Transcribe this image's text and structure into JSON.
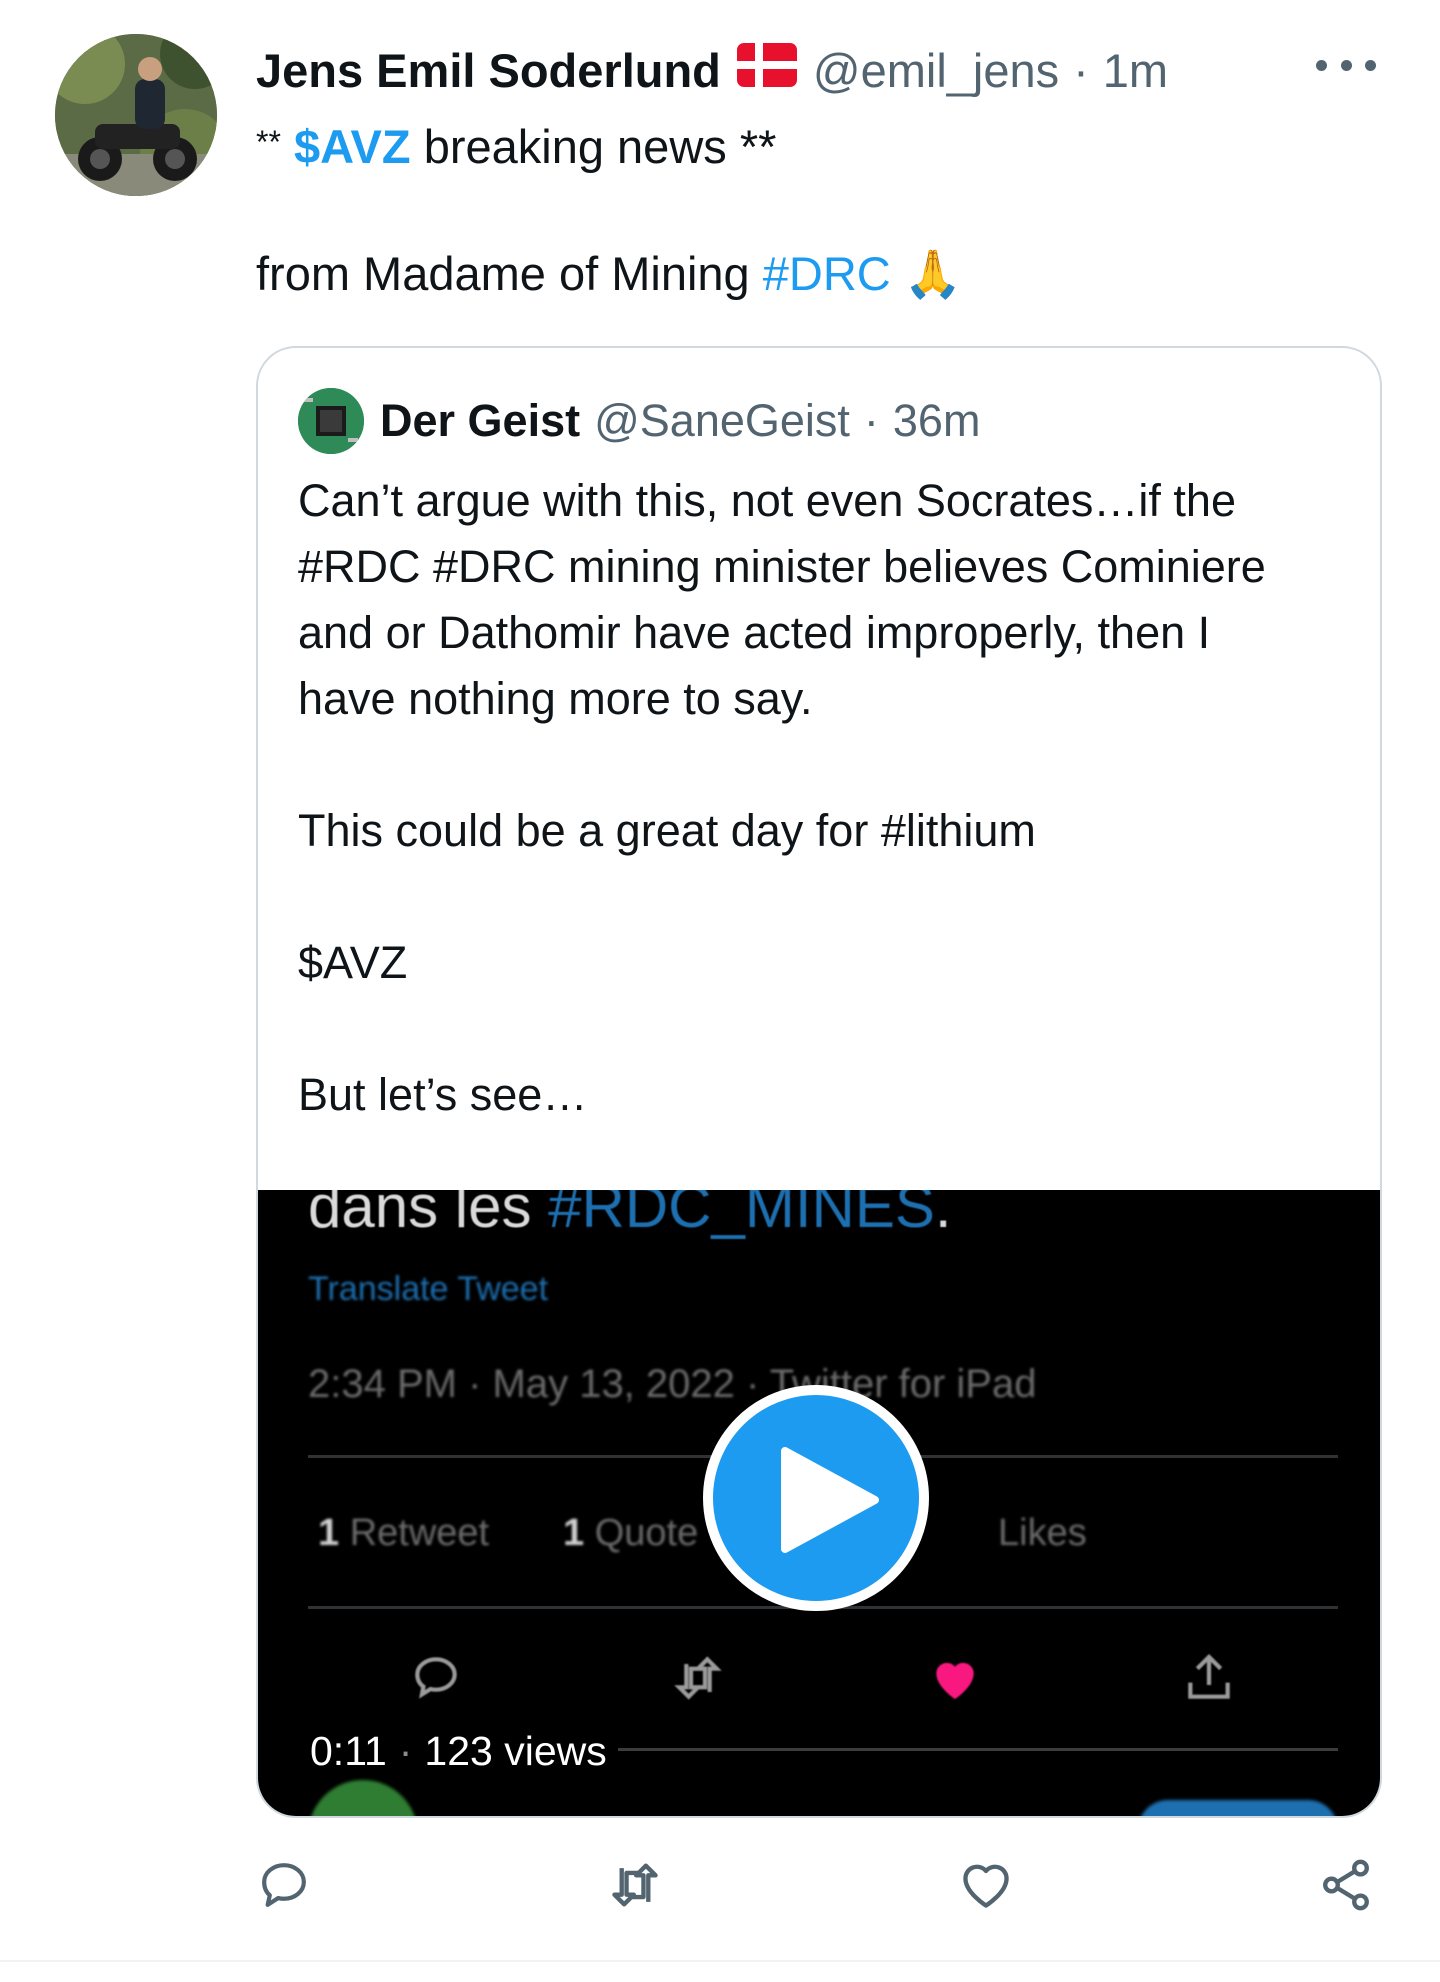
{
  "tweet": {
    "author_name": "Jens Emil Soderlund",
    "handle": "@emil_jens",
    "separator": "·",
    "time": "1m",
    "line1_prefix": "**",
    "line1_cashtag": "$AVZ",
    "line1_rest": "breaking news **",
    "line2_text": "from Madame of Mining",
    "line2_hashtag": "#DRC",
    "line2_emoji": "🙏"
  },
  "quote": {
    "author_name": "Der Geist",
    "handle": "@SaneGeist",
    "separator": "·",
    "time": "36m",
    "lines": [
      "Can’t argue with this, not even Socrates…if the",
      "#RDC #DRC mining minister believes Cominiere",
      "and or Dathomir have acted improperly, then I",
      "have nothing more to say.",
      "This could be a great day for #lithium",
      "$AVZ",
      "But let’s see…"
    ]
  },
  "video": {
    "overlay_text_prefix": "dans les",
    "overlay_text_hashtag": "#RDC_MINES",
    "overlay_text_suffix": ".",
    "translate_label": "Translate Tweet",
    "meta": "2:34 PM · May 13, 2022 · Twitter for iPad",
    "retweet_count": "1",
    "retweet_label": "Retweet",
    "quote_count": "1",
    "quote_label": "Quote",
    "likes_label": "Likes",
    "duration": "0:11",
    "dot": "·",
    "views": "123 views"
  },
  "colors": {
    "link": "#1d9bf0",
    "secondary_text": "#536471",
    "like_pink": "#f91880"
  },
  "icons": {
    "more": "more-horizontal-icon",
    "play": "play-icon",
    "reply": "reply-icon",
    "retweet": "retweet-icon",
    "like": "like-icon",
    "share": "share-icon"
  }
}
